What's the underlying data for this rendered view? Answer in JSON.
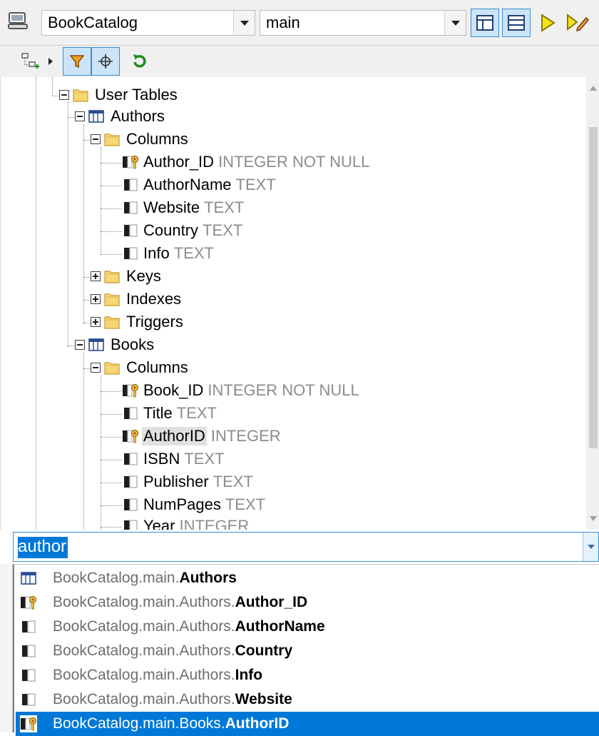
{
  "toolbar": {
    "database": "BookCatalog",
    "schema": "main",
    "icons": [
      "database-icon",
      "layout-icon",
      "layout-split-icon",
      "execute-icon",
      "execute-edit-icon"
    ]
  },
  "toolbar2": {
    "icons": [
      "add-object-icon",
      "filter-icon",
      "locate-icon",
      "refresh-icon"
    ]
  },
  "tree": {
    "user_tables": "User Tables",
    "authors": {
      "name": "Authors",
      "columns_label": "Columns",
      "columns": [
        {
          "name": "Author_ID",
          "type": "INTEGER NOT NULL"
        },
        {
          "name": "AuthorName",
          "type": "TEXT"
        },
        {
          "name": "Website",
          "type": "TEXT"
        },
        {
          "name": "Country",
          "type": "TEXT"
        },
        {
          "name": "Info",
          "type": "TEXT"
        }
      ],
      "keys": "Keys",
      "indexes": "Indexes",
      "triggers": "Triggers"
    },
    "books": {
      "name": "Books",
      "columns_label": "Columns",
      "columns": [
        {
          "name": "Book_ID",
          "type": "INTEGER NOT NULL"
        },
        {
          "name": "Title",
          "type": "TEXT"
        },
        {
          "name": "AuthorID",
          "type": "INTEGER"
        },
        {
          "name": "ISBN",
          "type": "TEXT"
        },
        {
          "name": "Publisher",
          "type": "TEXT"
        },
        {
          "name": "NumPages",
          "type": "TEXT"
        },
        {
          "name": "Year",
          "type": "INTEGER"
        }
      ]
    }
  },
  "search": {
    "value": "author"
  },
  "results": [
    {
      "prefix": "BookCatalog.main.",
      "match": "Authors",
      "icon": "table-icon"
    },
    {
      "prefix": "BookCatalog.main.Authors.",
      "match": "Author_ID",
      "icon": "key-column-icon"
    },
    {
      "prefix": "BookCatalog.main.Authors.",
      "match": "AuthorName",
      "icon": "column-icon"
    },
    {
      "prefix": "BookCatalog.main.Authors.",
      "match": "Country",
      "icon": "column-icon"
    },
    {
      "prefix": "BookCatalog.main.Authors.",
      "match": "Info",
      "icon": "column-icon"
    },
    {
      "prefix": "BookCatalog.main.Authors.",
      "match": "Website",
      "icon": "column-icon"
    },
    {
      "prefix": "BookCatalog.main.Books.",
      "match": "AuthorID",
      "icon": "key-column-icon",
      "selected": true
    }
  ]
}
